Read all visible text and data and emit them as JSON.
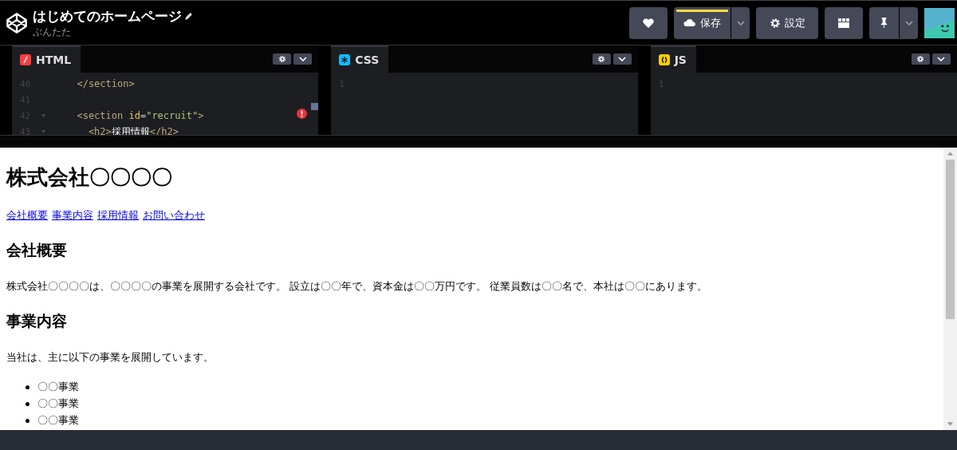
{
  "header": {
    "title": "はじめてのホームページ",
    "author": "ぶんたた",
    "buttons": [
      {
        "kind": "heart"
      },
      {
        "kind": "save",
        "label": "保存",
        "unsaved": true
      },
      {
        "kind": "settings",
        "label": "設定"
      },
      {
        "kind": "layout"
      },
      {
        "kind": "pin"
      }
    ]
  },
  "editors": [
    {
      "kind": "html",
      "tab": "HTML",
      "has_error": true,
      "lines": [
        {
          "number": "40",
          "tokens": [
            {
              "kind": "tag",
              "text": "  </section>"
            }
          ]
        },
        {
          "number": "41"
        },
        {
          "number": "42",
          "fold": true,
          "tokens": [
            {
              "kind": "tag",
              "text": "  <section "
            },
            {
              "kind": "attr",
              "text": "id"
            },
            {
              "kind": "punct",
              "text": "="
            },
            {
              "kind": "string",
              "text": "\"recruit\""
            },
            {
              "kind": "tag",
              "text": ">"
            }
          ]
        },
        {
          "number": "43",
          "fold": true,
          "tokens": [
            {
              "kind": "tag",
              "text": "    <h2>"
            },
            {
              "kind": "text",
              "text": "採用情報"
            },
            {
              "kind": "tag",
              "text": "</h2>"
            }
          ]
        }
      ]
    },
    {
      "kind": "css",
      "tab": "CSS",
      "lines": [
        {
          "number": "1"
        }
      ]
    },
    {
      "kind": "js",
      "tab": "JS",
      "lines": [
        {
          "number": "1"
        }
      ]
    }
  ],
  "preview": {
    "heading": "株式会社〇〇〇〇",
    "nav_links": [
      "会社概要",
      "事業内容",
      "採用情報",
      "お問い合わせ"
    ],
    "sections": [
      {
        "heading": "会社概要",
        "paragraph": "株式会社〇〇〇〇は、〇〇〇〇の事業を展開する会社です。 設立は〇〇年で、資本金は〇〇万円です。 従業員数は〇〇名で、本社は〇〇にあります。"
      },
      {
        "heading": "事業内容",
        "paragraph": "当社は、主に以下の事業を展開しています。",
        "items": [
          "〇〇事業",
          "〇〇事業",
          "〇〇事業"
        ]
      }
    ]
  }
}
